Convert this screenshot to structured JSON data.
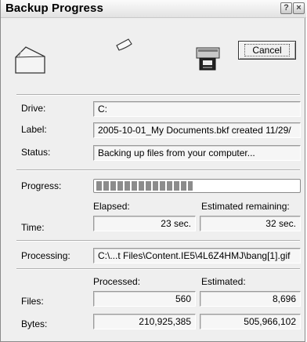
{
  "window": {
    "title": "Backup Progress",
    "help_label": "?",
    "close_label": "×"
  },
  "buttons": {
    "cancel_label": "Cancel"
  },
  "icons": {
    "folder": "folder-icon",
    "flying_document": "document-icon",
    "backup_drive": "tape-drive-icon"
  },
  "info": {
    "drive_label": "Drive:",
    "drive_value": "C:",
    "label_label": "Label:",
    "label_value": "2005-10-01_My Documents.bkf created 11/29/",
    "status_label": "Status:",
    "status_value": "Backing up files from your computer..."
  },
  "progress": {
    "label": "Progress:",
    "percent": 48
  },
  "time": {
    "label": "Time:",
    "elapsed_header": "Elapsed:",
    "remaining_header": "Estimated remaining:",
    "elapsed_value": "23 sec.",
    "remaining_value": "32 sec."
  },
  "processing": {
    "label": "Processing:",
    "value": "C:\\...t Files\\Content.IE5\\4L6Z4HMJ\\bang[1].gif"
  },
  "counts": {
    "processed_header": "Processed:",
    "estimated_header": "Estimated:",
    "files_label": "Files:",
    "files_processed": "560",
    "files_estimated": "8,696",
    "bytes_label": "Bytes:",
    "bytes_processed": "210,925,385",
    "bytes_estimated": "505,966,102"
  }
}
